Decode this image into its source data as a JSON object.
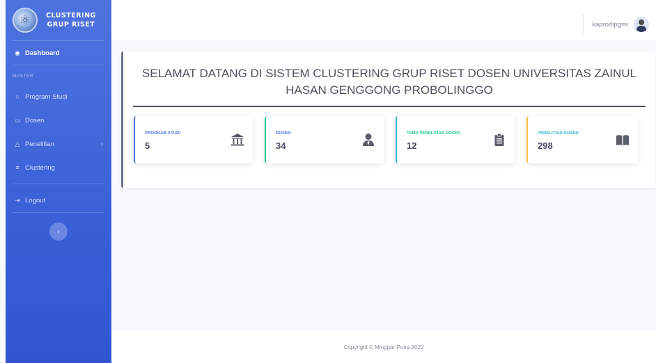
{
  "brand": {
    "line1": "CLUSTERING",
    "line2": "GRUP RISET"
  },
  "sidebar": {
    "dashboard": "Dashboard",
    "heading": "MASTER",
    "items": [
      {
        "label": "Program Studi"
      },
      {
        "label": "Dosen"
      },
      {
        "label": "Penelitian"
      },
      {
        "label": "Clustering"
      }
    ],
    "logout": "Logout",
    "toggle": "‹"
  },
  "topbar": {
    "username": "kaprodipgmi"
  },
  "main": {
    "welcome": "SELAMAT DATANG DI SISTEM CLUSTERING GRUP RISET DOSEN UNIVERSITAS ZAINUL HASAN GENGGONG PROBOLINGGO",
    "stats": [
      {
        "label": "PROGRAM STUDI",
        "value": "5"
      },
      {
        "label": "DOSEN",
        "value": "34"
      },
      {
        "label": "TEMA PENELITIAN DOSEN",
        "value": "12"
      },
      {
        "label": "PENELITIAN DOSEN",
        "value": "298"
      }
    ]
  },
  "footer": {
    "text": "Copyright © Minggar Putra 2022"
  },
  "colors": {
    "primary": "#4e73df",
    "success": "#1cc88a",
    "info": "#36b9cc",
    "warning": "#f6c23e",
    "icon": "#5a5c69"
  }
}
